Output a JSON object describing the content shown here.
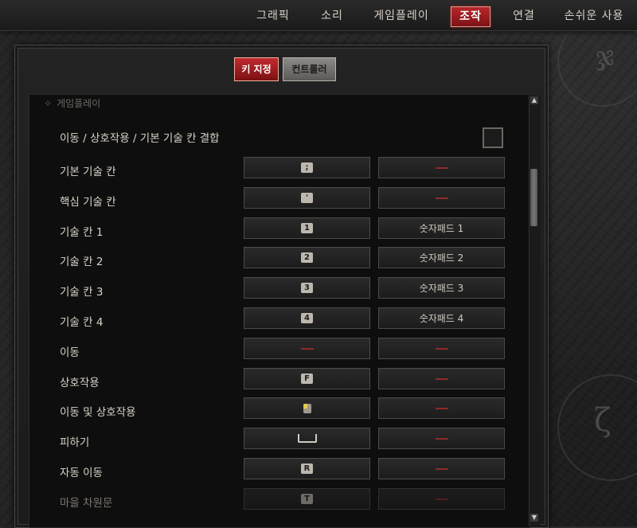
{
  "top_nav": {
    "tabs": [
      {
        "label": "그래픽",
        "active": false
      },
      {
        "label": "소리",
        "active": false
      },
      {
        "label": "게임플레이",
        "active": false
      },
      {
        "label": "조작",
        "active": true
      },
      {
        "label": "연결",
        "active": false
      },
      {
        "label": "손쉬운 사용",
        "active": false
      }
    ]
  },
  "sub_tabs": {
    "keybind_label": "키 지정",
    "controller_label": "컨트롤러"
  },
  "section": {
    "header": "게임플레이"
  },
  "combine_option": {
    "label": "이동 / 상호작용 / 기본 기술 칸 결합",
    "checked": false
  },
  "bindings": [
    {
      "label": "기본 기술 칸",
      "primary": ";",
      "primary_type": "key",
      "secondary": "",
      "secondary_type": "unbound"
    },
    {
      "label": "핵심 기술 칸",
      "primary": "'",
      "primary_type": "key",
      "secondary": "",
      "secondary_type": "unbound"
    },
    {
      "label": "기술 칸 1",
      "primary": "1",
      "primary_type": "key",
      "secondary": "숫자패드 1",
      "secondary_type": "text"
    },
    {
      "label": "기술 칸 2",
      "primary": "2",
      "primary_type": "key",
      "secondary": "숫자패드 2",
      "secondary_type": "text"
    },
    {
      "label": "기술 칸 3",
      "primary": "3",
      "primary_type": "key",
      "secondary": "숫자패드 3",
      "secondary_type": "text"
    },
    {
      "label": "기술 칸 4",
      "primary": "4",
      "primary_type": "key",
      "secondary": "숫자패드 4",
      "secondary_type": "text"
    },
    {
      "label": "이동",
      "primary": "",
      "primary_type": "unbound",
      "secondary": "",
      "secondary_type": "unbound"
    },
    {
      "label": "상호작용",
      "primary": "F",
      "primary_type": "key",
      "secondary": "",
      "secondary_type": "unbound"
    },
    {
      "label": "이동 및 상호작용",
      "primary": "mouse-left-click",
      "primary_type": "mouse",
      "secondary": "",
      "secondary_type": "unbound"
    },
    {
      "label": "피하기",
      "primary": "spacebar",
      "primary_type": "space",
      "secondary": "",
      "secondary_type": "unbound"
    },
    {
      "label": "자동 이동",
      "primary": "R",
      "primary_type": "key",
      "secondary": "",
      "secondary_type": "unbound"
    },
    {
      "label": "마을 차원문",
      "primary": "T",
      "primary_type": "key",
      "secondary": "",
      "secondary_type": "unbound",
      "dim": true
    }
  ],
  "colors": {
    "accent_red": "#b8262b",
    "unbound_dash": "#8e2a26",
    "panel_bg": "#0e0e0e"
  }
}
